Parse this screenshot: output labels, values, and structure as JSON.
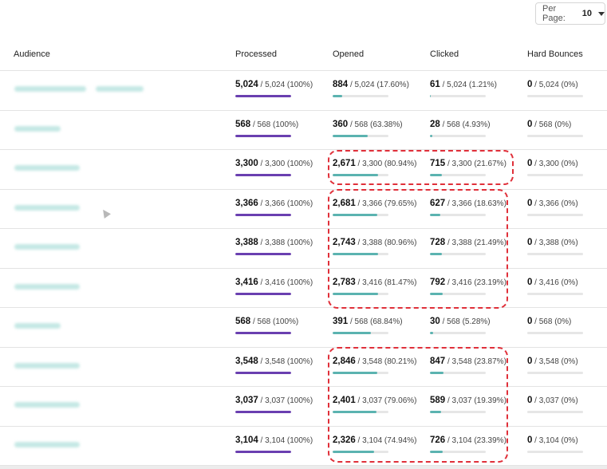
{
  "per_page": {
    "label": "Per Page:",
    "value": "10"
  },
  "columns": {
    "audience": "Audience",
    "processed": "Processed",
    "opened": "Opened",
    "clicked": "Clicked",
    "hard_bounces": "Hard Bounces"
  },
  "rows": [
    {
      "processed": {
        "value": "5,024",
        "detail": " / 5,024 (100%)",
        "fraction": 1.0
      },
      "opened": {
        "value": "884",
        "detail": " / 5,024 (17.60%)",
        "fraction": 0.176
      },
      "clicked": {
        "value": "61",
        "detail": " / 5,024 (1.21%)",
        "fraction": 0.0121
      },
      "bounces": {
        "value": "0",
        "detail": " / 5,024 (0%)",
        "fraction": 0
      }
    },
    {
      "processed": {
        "value": "568",
        "detail": " / 568 (100%)",
        "fraction": 1.0
      },
      "opened": {
        "value": "360",
        "detail": " / 568 (63.38%)",
        "fraction": 0.6338
      },
      "clicked": {
        "value": "28",
        "detail": " / 568 (4.93%)",
        "fraction": 0.0493
      },
      "bounces": {
        "value": "0",
        "detail": " / 568 (0%)",
        "fraction": 0
      }
    },
    {
      "processed": {
        "value": "3,300",
        "detail": " / 3,300 (100%)",
        "fraction": 1.0
      },
      "opened": {
        "value": "2,671",
        "detail": " / 3,300 (80.94%)",
        "fraction": 0.8094
      },
      "clicked": {
        "value": "715",
        "detail": " / 3,300 (21.67%)",
        "fraction": 0.2167
      },
      "bounces": {
        "value": "0",
        "detail": " / 3,300 (0%)",
        "fraction": 0
      }
    },
    {
      "processed": {
        "value": "3,366",
        "detail": " / 3,366 (100%)",
        "fraction": 1.0
      },
      "opened": {
        "value": "2,681",
        "detail": " / 3,366 (79.65%)",
        "fraction": 0.7965
      },
      "clicked": {
        "value": "627",
        "detail": " / 3,366 (18.63%)",
        "fraction": 0.1863
      },
      "bounces": {
        "value": "0",
        "detail": " / 3,366 (0%)",
        "fraction": 0
      }
    },
    {
      "processed": {
        "value": "3,388",
        "detail": " / 3,388 (100%)",
        "fraction": 1.0
      },
      "opened": {
        "value": "2,743",
        "detail": " / 3,388 (80.96%)",
        "fraction": 0.8096
      },
      "clicked": {
        "value": "728",
        "detail": " / 3,388 (21.49%)",
        "fraction": 0.2149
      },
      "bounces": {
        "value": "0",
        "detail": " / 3,388 (0%)",
        "fraction": 0
      }
    },
    {
      "processed": {
        "value": "3,416",
        "detail": " / 3,416 (100%)",
        "fraction": 1.0
      },
      "opened": {
        "value": "2,783",
        "detail": " / 3,416 (81.47%)",
        "fraction": 0.8147
      },
      "clicked": {
        "value": "792",
        "detail": " / 3,416 (23.19%)",
        "fraction": 0.2319
      },
      "bounces": {
        "value": "0",
        "detail": " / 3,416 (0%)",
        "fraction": 0
      }
    },
    {
      "processed": {
        "value": "568",
        "detail": " / 568 (100%)",
        "fraction": 1.0
      },
      "opened": {
        "value": "391",
        "detail": " / 568 (68.84%)",
        "fraction": 0.6884
      },
      "clicked": {
        "value": "30",
        "detail": " / 568 (5.28%)",
        "fraction": 0.0528
      },
      "bounces": {
        "value": "0",
        "detail": " / 568 (0%)",
        "fraction": 0
      }
    },
    {
      "processed": {
        "value": "3,548",
        "detail": " / 3,548 (100%)",
        "fraction": 1.0
      },
      "opened": {
        "value": "2,846",
        "detail": " / 3,548 (80.21%)",
        "fraction": 0.8021
      },
      "clicked": {
        "value": "847",
        "detail": " / 3,548 (23.87%)",
        "fraction": 0.2387
      },
      "bounces": {
        "value": "0",
        "detail": " / 3,548 (0%)",
        "fraction": 0
      }
    },
    {
      "processed": {
        "value": "3,037",
        "detail": " / 3,037 (100%)",
        "fraction": 1.0
      },
      "opened": {
        "value": "2,401",
        "detail": " / 3,037 (79.06%)",
        "fraction": 0.7906
      },
      "clicked": {
        "value": "589",
        "detail": " / 3,037 (19.39%)",
        "fraction": 0.1939
      },
      "bounces": {
        "value": "0",
        "detail": " / 3,037 (0%)",
        "fraction": 0
      }
    },
    {
      "processed": {
        "value": "3,104",
        "detail": " / 3,104 (100%)",
        "fraction": 1.0
      },
      "opened": {
        "value": "2,326",
        "detail": " / 3,104 (74.94%)",
        "fraction": 0.7494
      },
      "clicked": {
        "value": "726",
        "detail": " / 3,104 (23.39%)",
        "fraction": 0.2339
      },
      "bounces": {
        "value": "0",
        "detail": " / 3,104 (0%)",
        "fraction": 0
      }
    }
  ],
  "colors": {
    "processed_bar": "#6a3fb0",
    "rate_bar": "#5bb3b0",
    "highlight": "#e0303a"
  }
}
